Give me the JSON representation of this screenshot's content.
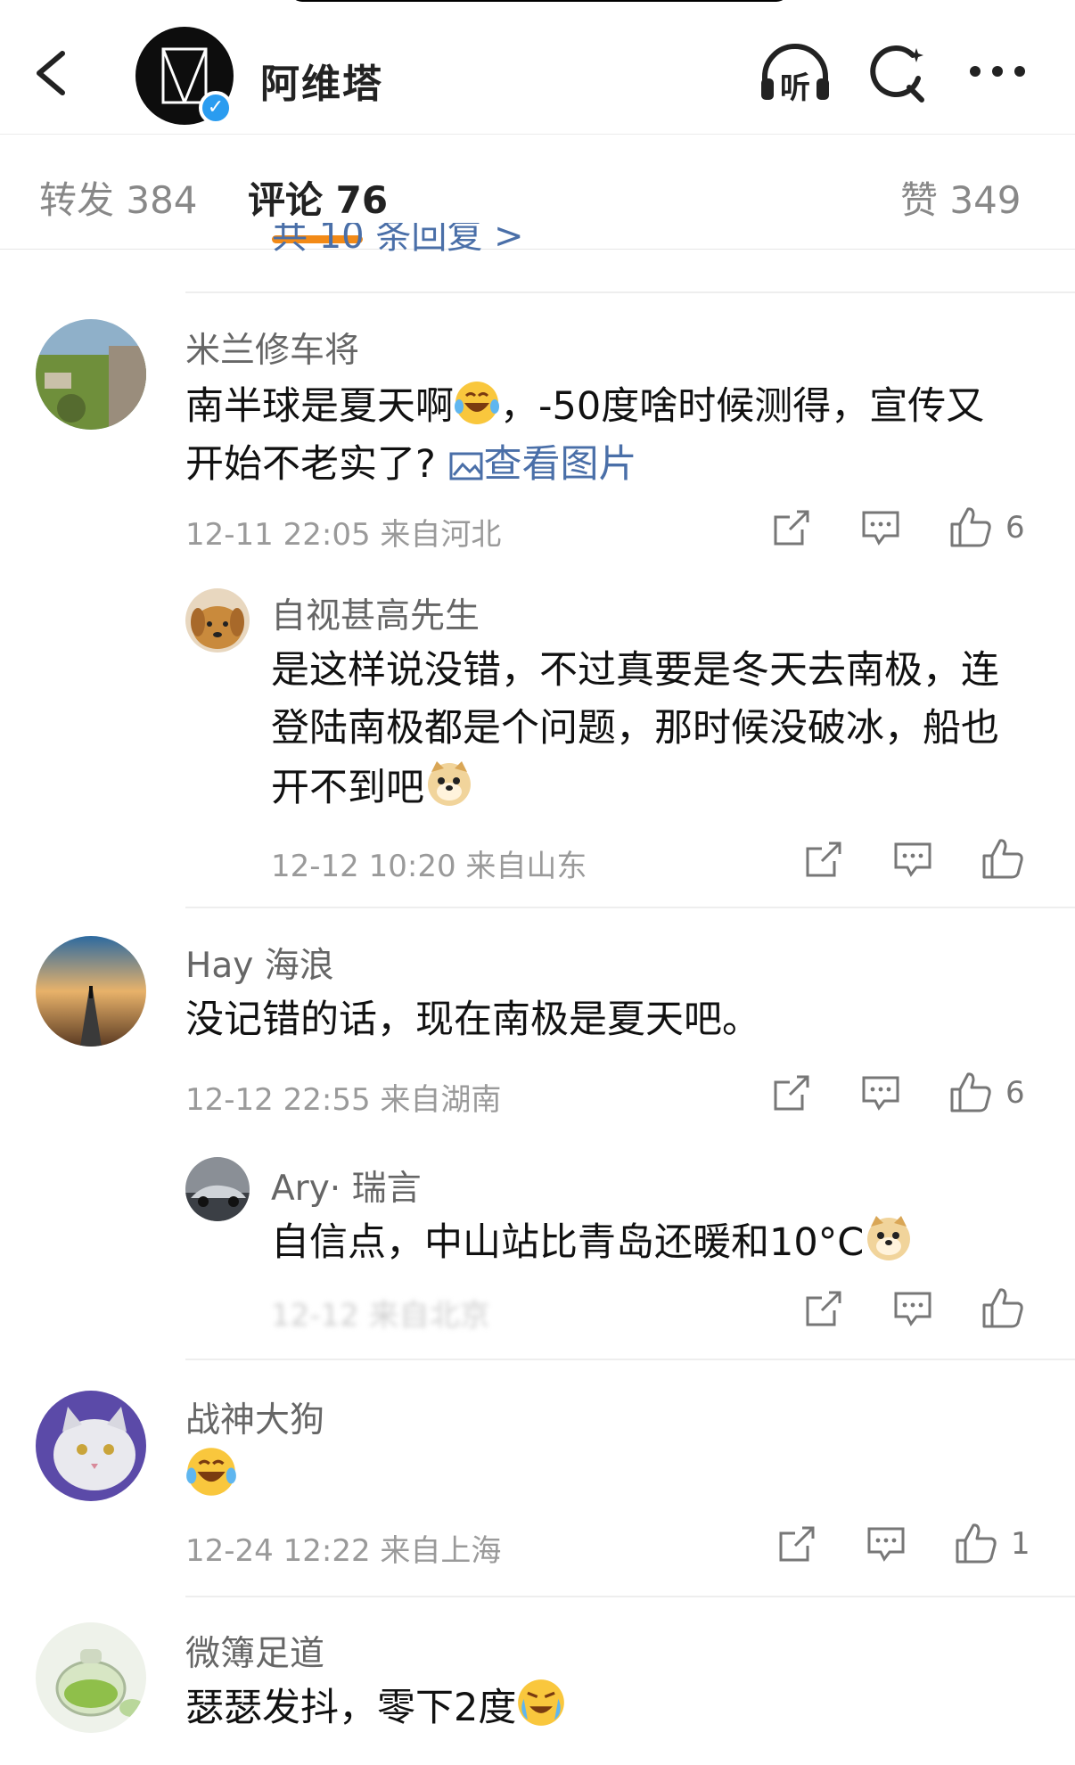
{
  "header": {
    "account_name": "阿维塔",
    "icons": [
      "back-arrow-icon",
      "listen-headphone-icon",
      "search-icon",
      "more-icon"
    ],
    "listen_label": "听"
  },
  "tabs": [
    {
      "label": "转发 384",
      "active": false
    },
    {
      "label": "评论 76",
      "active": true
    },
    {
      "label": "赞 349",
      "active": false
    }
  ],
  "accent_color": "#f28a17",
  "link_color": "#4a6fa8",
  "partial_link": "共 10 条回复 >",
  "comments": [
    {
      "user": "米兰修车将",
      "text_1": "南半球是夏天啊",
      "text_2": "，-50度啥时候测得，宣传又",
      "text_3": "开始不老实了?",
      "image_link": "查看图片",
      "meta": "12-11 22:05  来自河北",
      "likes": "6",
      "reply": {
        "user": "自视甚高先生",
        "line_1": "是这样说没错，不过真要是冬天去南极，连",
        "line_2": "登陆南极都是个问题，那时候没破冰，船也",
        "line_3": "开不到吧",
        "meta": "12-12 10:20  来自山东"
      }
    },
    {
      "user": "Hay 海浪",
      "text_1": "没记错的话，现在南极是夏天吧。",
      "meta": "12-12 22:55  来自湖南",
      "likes": "6",
      "reply": {
        "user": "Ary· 瑞言",
        "line_1": "自信点，中山站比青岛还暖和10°C",
        "meta": "12-12 来自北京"
      }
    },
    {
      "user": "战神大狗",
      "meta": "12-24 12:22  来自上海",
      "likes": "1"
    },
    {
      "user": "微簿足道",
      "text_1": "瑟瑟发抖，零下2度"
    }
  ]
}
